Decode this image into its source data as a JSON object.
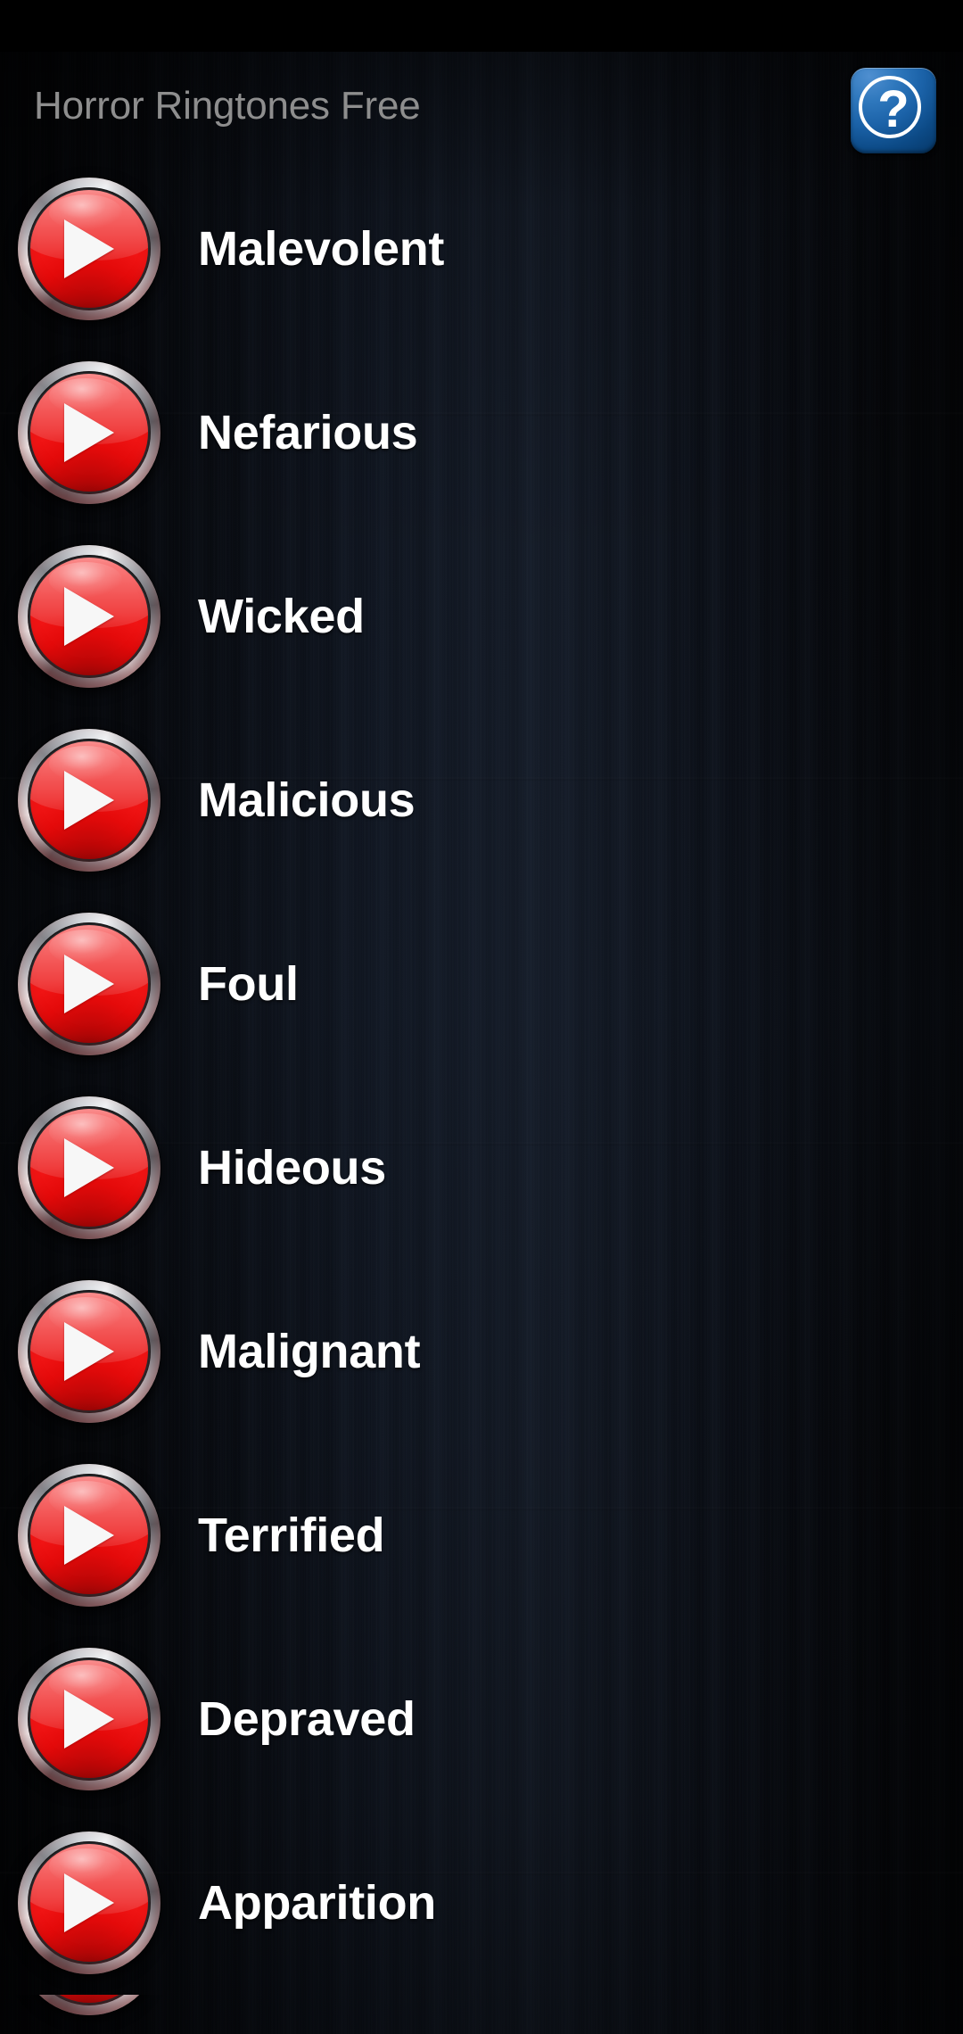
{
  "app": {
    "title": "Horror Ringtones Free",
    "title_color": "#8e8e8e",
    "background_color": "#0a0d14",
    "status_bar_color": "#000000"
  },
  "header": {
    "title": "Horror Ringtones Free",
    "help_button": {
      "icon": "question-mark-icon",
      "glyph": "?",
      "color": "#1b62a8"
    }
  },
  "list": {
    "play_icon": "play-triangle-icon",
    "accent_color": "#e40a0a",
    "items": [
      {
        "label": "Malevolent"
      },
      {
        "label": "Nefarious"
      },
      {
        "label": "Wicked"
      },
      {
        "label": "Malicious"
      },
      {
        "label": "Foul"
      },
      {
        "label": "Hideous"
      },
      {
        "label": "Malignant"
      },
      {
        "label": "Terrified"
      },
      {
        "label": "Depraved"
      },
      {
        "label": "Apparition"
      }
    ]
  }
}
